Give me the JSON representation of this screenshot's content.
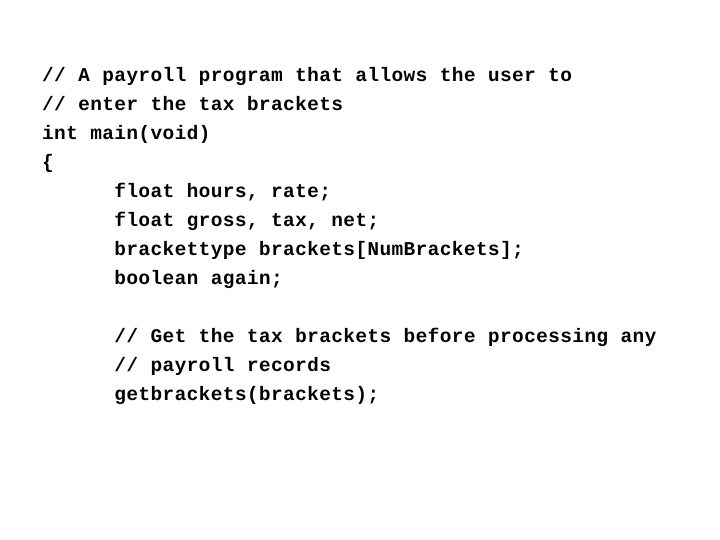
{
  "slide": {
    "background_color": "#ffffff",
    "text_color": "#000000",
    "code_lines": [
      {
        "text": "// A payroll program that allows the user to",
        "indent": 0,
        "kind": "comment"
      },
      {
        "text": "// enter the tax brackets",
        "indent": 0,
        "kind": "comment"
      },
      {
        "text": "int main(void)",
        "indent": 0,
        "kind": "code"
      },
      {
        "text": "{",
        "indent": 0,
        "kind": "code"
      },
      {
        "text": "      float hours, rate;",
        "indent": 6,
        "kind": "code"
      },
      {
        "text": "      float gross, tax, net;",
        "indent": 6,
        "kind": "code"
      },
      {
        "text": "      brackettype brackets[NumBrackets];",
        "indent": 6,
        "kind": "code"
      },
      {
        "text": "      boolean again;",
        "indent": 6,
        "kind": "code"
      },
      {
        "text": " ",
        "indent": 0,
        "kind": "blank"
      },
      {
        "text": "      // Get the tax brackets before processing any",
        "indent": 6,
        "kind": "comment"
      },
      {
        "text": "      // payroll records",
        "indent": 6,
        "kind": "comment"
      },
      {
        "text": "      getbrackets(brackets);",
        "indent": 6,
        "kind": "code"
      }
    ]
  }
}
